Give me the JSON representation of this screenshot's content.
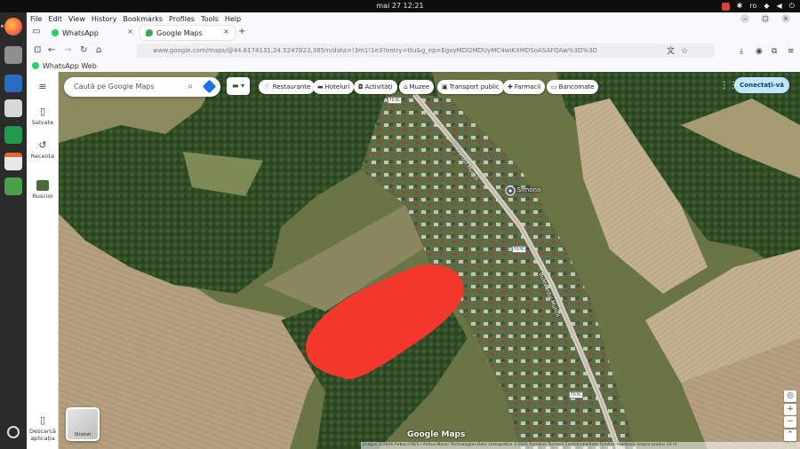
{
  "system": {
    "clock": "mai 27  12:21",
    "locale": "ro"
  },
  "menubar": [
    "File",
    "Edit",
    "View",
    "History",
    "Bookmarks",
    "Profiles",
    "Tools",
    "Help"
  ],
  "tabs": [
    {
      "label": "WhatsApp",
      "icon": "whatsapp-icon"
    },
    {
      "label": "Google Maps",
      "icon": "google-maps-icon"
    }
  ],
  "url": "www.google.com/maps/@44.6174131,24.5247823,385m/data=!3m1!1e3?entry=ttu&g_ep=EgoyMDI2MDUyMC4wIKXMDSoASAFQAw%3D%3D",
  "bookmarks": [
    "WhatsApp Web"
  ],
  "rail": {
    "saved": "Salvate",
    "recent": "Recente",
    "item": "Ruscioi",
    "download": "Descarcă aplicația"
  },
  "search": {
    "placeholder": "Caută pe Google Maps"
  },
  "chips": [
    "Restaurante",
    "Hoteluri",
    "Activități",
    "Muzee",
    "Transport public",
    "Farmacii",
    "Bancomate"
  ],
  "signin": "Conectați-vă",
  "layers": "Straturi",
  "map": {
    "logo": "Google Maps",
    "attribution": "Imagini ©2026 Airbus,CNES / Airbus,Maxar Technologies,Date cartografice ©2026   România   Termeni   Confidențialitate   Trimiteți feedback despre produs   20 m",
    "place": "Simona",
    "road_name": "Bulevardul Muncii",
    "road_shield": "703C",
    "highlight_color": "#f2382d"
  }
}
